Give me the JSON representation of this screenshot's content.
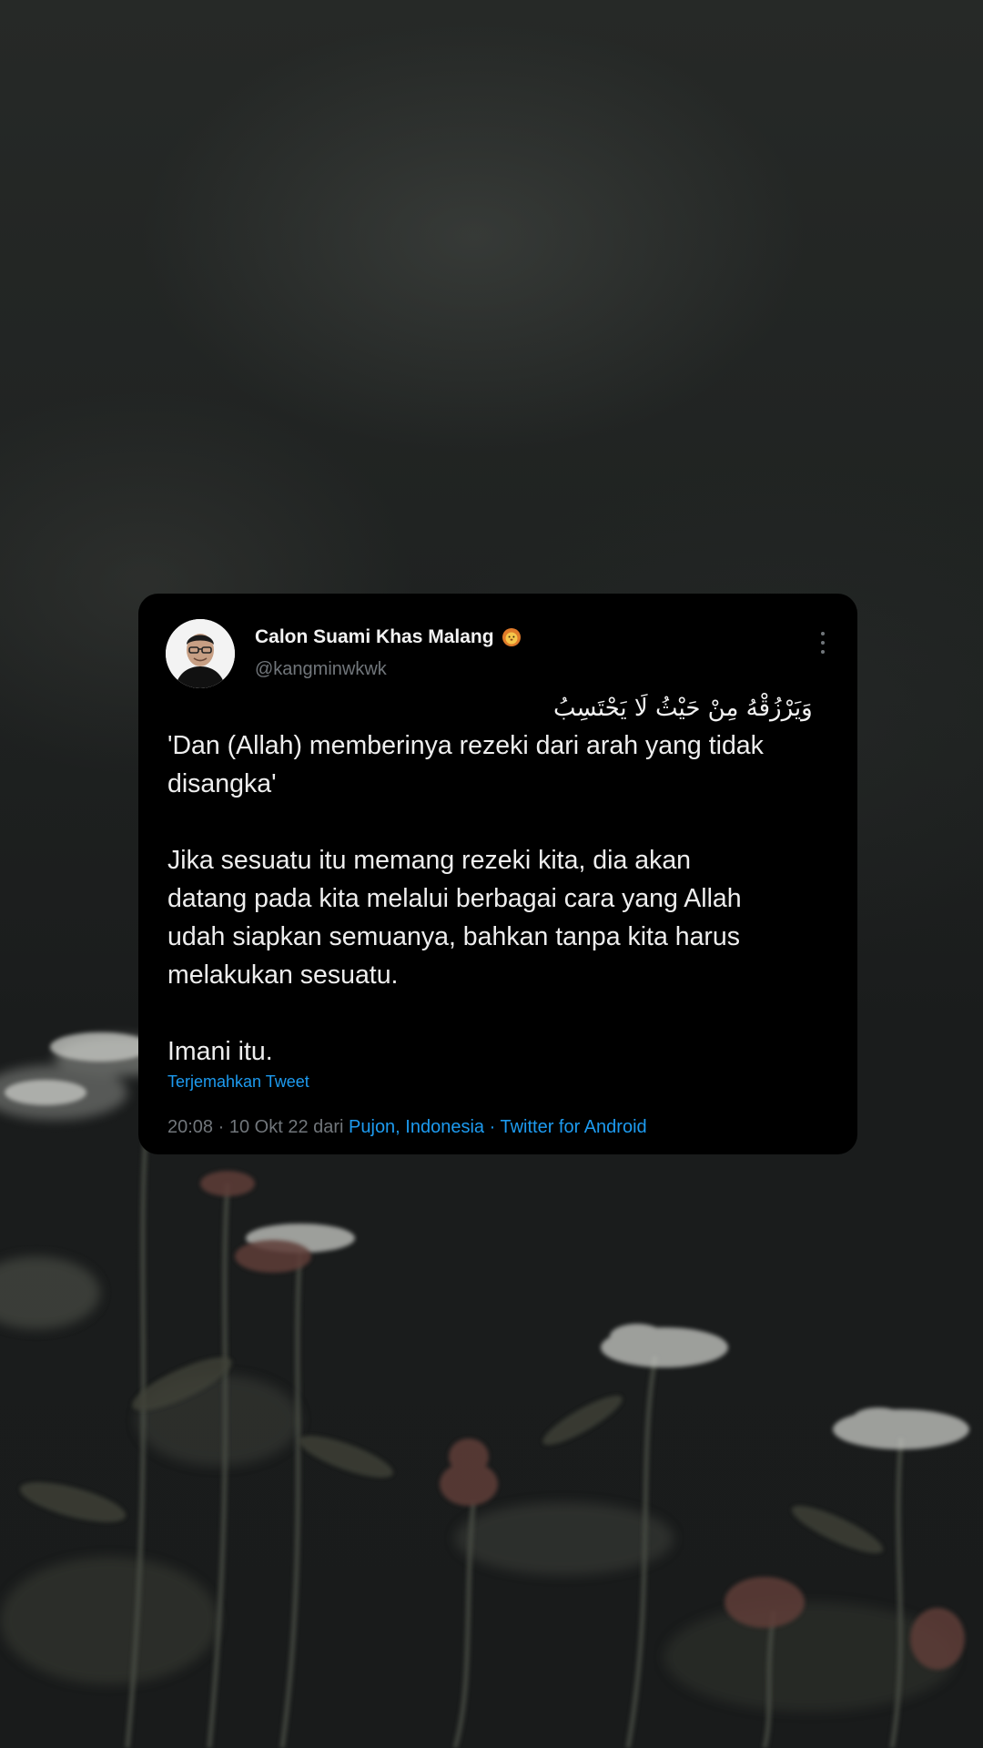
{
  "tweet": {
    "author": {
      "display_name": "Calon Suami Khas Malang",
      "badge_icon": "lion-emoji-icon",
      "handle": "@kangminwkwk"
    },
    "arabic_line": "وَيَرْزُقْهُ مِنْ حَيْثُ لَا يَحْتَسِبُ",
    "text": "'Dan (Allah) memberinya rezeki dari arah yang tidak\ndisangka'\n\nJika sesuatu itu memang rezeki kita, dia akan\ndatang pada kita melalui berbagai cara yang Allah\nudah siapkan semuanya, bahkan tanpa kita harus\nmelakukan sesuatu.\n\n Imani itu.",
    "translate_label": "Terjemahkan Tweet",
    "meta": {
      "time": "20:08",
      "sep1": " · ",
      "date": "10 Okt 22",
      "from_label": " dari ",
      "location": "Pujon, Indonesia",
      "sep2": " · ",
      "client": "Twitter for Android"
    }
  },
  "colors": {
    "card_bg": "#000000",
    "link": "#1d9bf0",
    "muted": "#71767b",
    "text": "#eeeeee"
  }
}
